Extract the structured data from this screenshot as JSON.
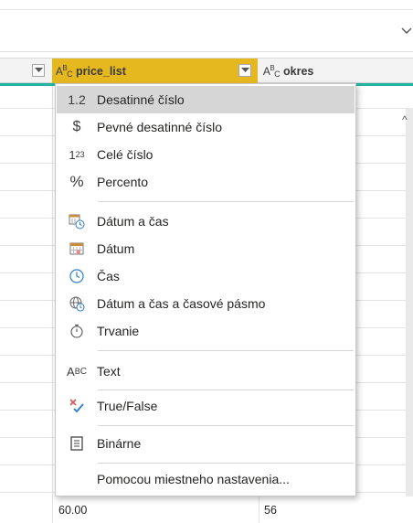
{
  "header": {
    "selected_column": {
      "type_icon": "ABC",
      "label": "price_list"
    },
    "next_column": {
      "type_icon": "ABC",
      "label": "okres"
    }
  },
  "type_menu": {
    "items": [
      {
        "icon": "1.2",
        "label": "Desatinné číslo",
        "selected": true
      },
      {
        "icon": "$",
        "label": "Pevné desatinné číslo"
      },
      {
        "icon": "123",
        "label": "Celé číslo"
      },
      {
        "icon": "%",
        "label": "Percento"
      },
      {
        "icon": "datetime-icon",
        "label": "Dátum a čas"
      },
      {
        "icon": "calendar-icon",
        "label": "Dátum"
      },
      {
        "icon": "clock-icon",
        "label": "Čas"
      },
      {
        "icon": "globe-clock-icon",
        "label": "Dátum a čas a časové pásmo"
      },
      {
        "icon": "stopwatch-icon",
        "label": "Trvanie"
      },
      {
        "icon": "ABC",
        "label": "Text"
      },
      {
        "icon": "true-false-icon",
        "label": "True/False"
      },
      {
        "icon": "binary-icon",
        "label": "Binárne"
      },
      {
        "icon": "",
        "label": "Pomocou miestneho nastavenia..."
      }
    ]
  },
  "grid": {
    "bottom_row": {
      "price_list": "60.00",
      "okres": "56"
    }
  },
  "colors": {
    "selected_header": "#e6b820",
    "accent_line": "#22b3a2",
    "selected_item": "#d6d6d6"
  }
}
